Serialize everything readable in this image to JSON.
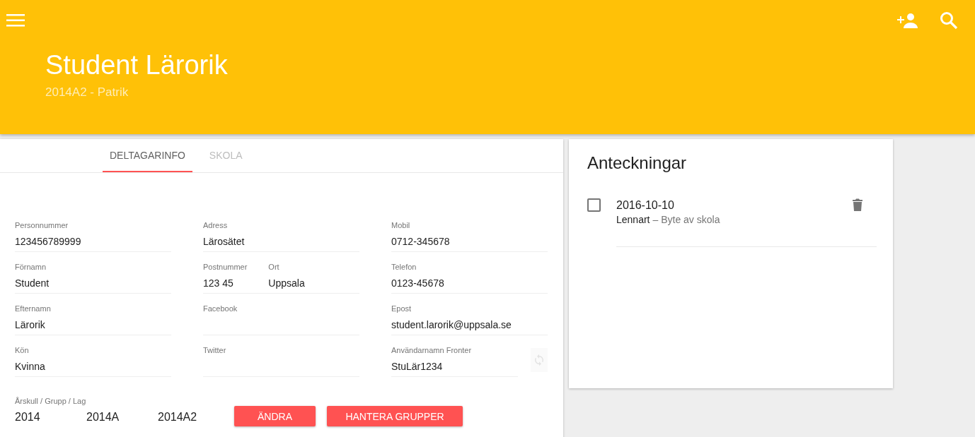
{
  "header": {
    "title": "Student Lärorik",
    "subtitle": "2014A2 - Patrik"
  },
  "tabs": [
    {
      "label": "DELTAGARINFO",
      "selected": true
    },
    {
      "label": "SKOLA",
      "selected": false
    }
  ],
  "field_columns": [
    [
      {
        "kind": "text",
        "label": "Personnummer",
        "value": "123456789999"
      },
      {
        "kind": "text",
        "label": "Förnamn",
        "value": "Student"
      },
      {
        "kind": "text",
        "label": "Efternamn",
        "value": "Lärorik"
      },
      {
        "kind": "text",
        "label": "Kön",
        "value": "Kvinna"
      }
    ],
    [
      {
        "kind": "text",
        "label": "Adress",
        "value": "Lärosätet"
      },
      {
        "kind": "pair",
        "parts": [
          {
            "label": "Postnummer",
            "value": "123 45"
          },
          {
            "label": "Ort",
            "value": "Uppsala"
          }
        ]
      },
      {
        "kind": "text",
        "label": "Facebook"
      },
      {
        "kind": "text",
        "label": "Twitter"
      }
    ],
    [
      {
        "kind": "text",
        "label": "Mobil",
        "value": "0712-345678"
      },
      {
        "kind": "text",
        "label": "Telefon",
        "value": "0123-45678"
      },
      {
        "kind": "text",
        "label": "Epost",
        "value": "student.larorik@uppsala.se"
      },
      {
        "kind": "sync",
        "label": "Användarnamn Fronter",
        "value": "StuLär1234"
      }
    ]
  ],
  "group": {
    "label": "Årskull / Grupp / Lag",
    "values": [
      "2014",
      "2014A",
      "2014A2"
    ]
  },
  "buttons": [
    "ÄNDRA",
    "HANTERA GRUPPER"
  ],
  "notes": {
    "title": "Anteckningar",
    "items": [
      {
        "checked": false,
        "date": "2016-10-10",
        "author": "Lennart",
        "text": "– Byte av skola"
      }
    ]
  }
}
